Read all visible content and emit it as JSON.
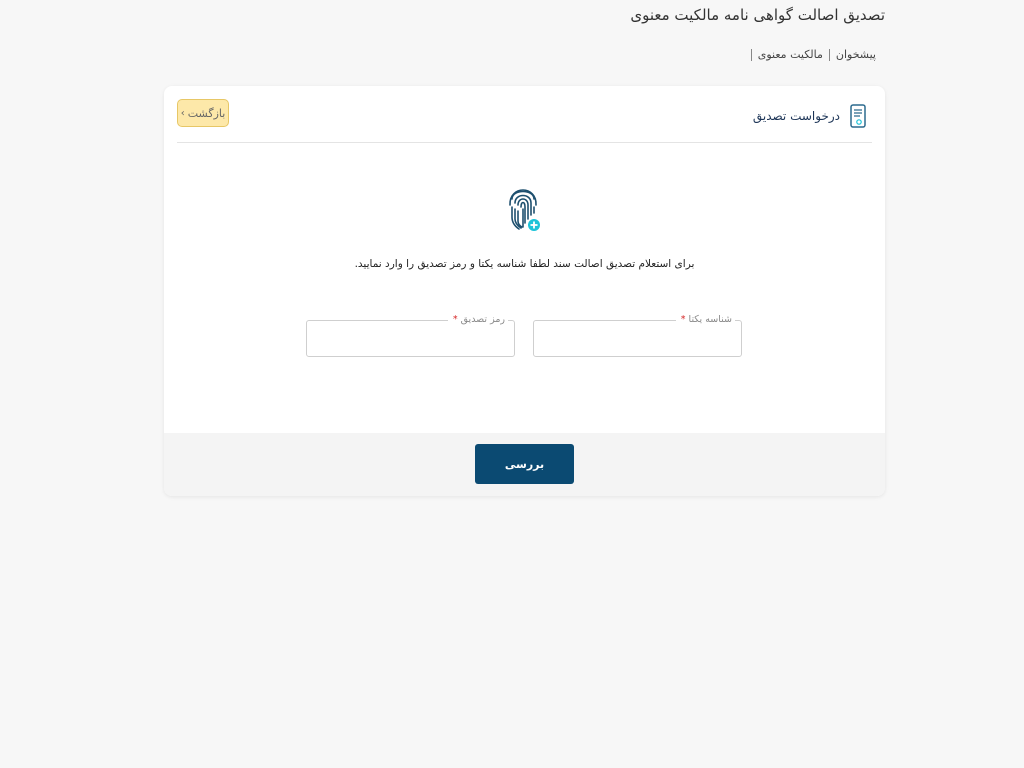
{
  "page": {
    "title": "تصدیق اصالت گواهی نامه مالکیت معنوی"
  },
  "breadcrumb": {
    "items": [
      "پیشخوان",
      "مالکیت معنوی"
    ]
  },
  "card": {
    "header_title": "درخواست تصدیق",
    "back_label": "بازگشت",
    "instructions": "برای استعلام تصدیق اصالت سند لطفا شناسه یکتا و رمز تصدیق را وارد نمایید.",
    "fields": {
      "unique_id": {
        "label": "شناسه یکتا",
        "required": "*",
        "value": ""
      },
      "verification_code": {
        "label": "رمز تصدیق",
        "required": "*",
        "value": ""
      }
    },
    "submit_label": "بررسی"
  },
  "colors": {
    "primary": "#0b4a72",
    "back_bg": "#fde8a9",
    "accent_teal": "#1cc3d8",
    "required": "#d62828"
  },
  "icons": {
    "header": "document-icon",
    "fingerprint": "fingerprint-icon",
    "plus_badge": "plus-circle-icon",
    "back": "chevron-right-icon"
  }
}
